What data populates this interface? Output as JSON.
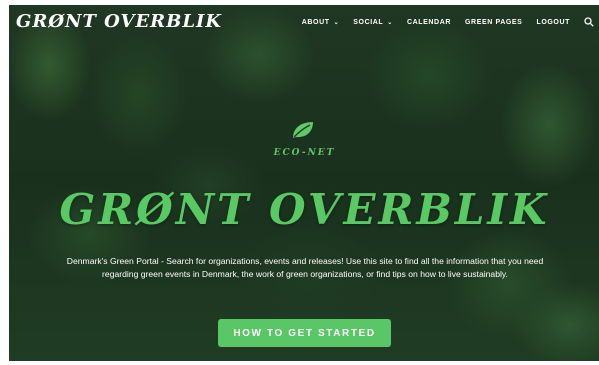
{
  "nav": {
    "logo": "GRØNT OVERBLIK",
    "items": [
      {
        "label": "ABOUT",
        "dropdown": true
      },
      {
        "label": "SOCIAL",
        "dropdown": true
      },
      {
        "label": "CALENDAR",
        "dropdown": false
      },
      {
        "label": "GREEN PAGES",
        "dropdown": false
      },
      {
        "label": "LOGOUT",
        "dropdown": false
      }
    ],
    "search_icon": "search-icon"
  },
  "hero": {
    "leaf_icon": "leaf-icon",
    "tagline": "ECO-NET",
    "title": "GRØNT OVERBLIK",
    "description": "Denmark's Green Portal - Search for organizations, events and releases! Use this site to find all the information that you need regarding green events in Denmark, the work of green organizations, or find tips on how to live sustainably.",
    "cta_label": "HOW TO GET STARTED"
  },
  "colors": {
    "accent_green": "#59c766",
    "title_green": "#58c963",
    "forest_dark": "#1f3b24",
    "text_white": "#ffffff"
  }
}
